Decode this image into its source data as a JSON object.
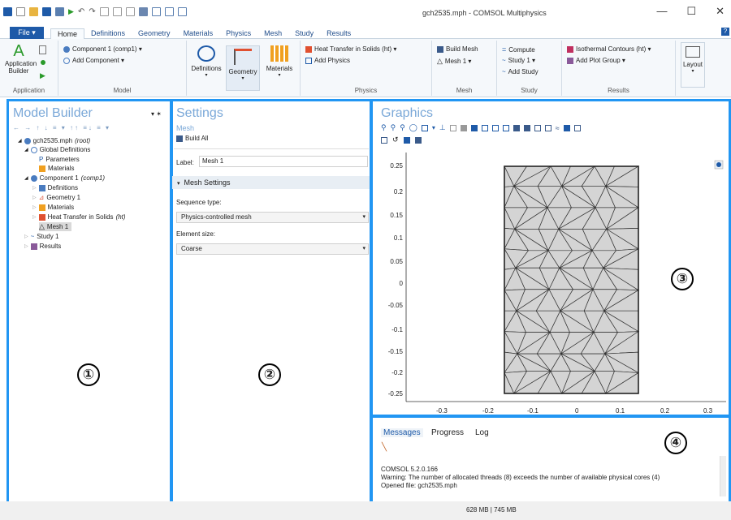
{
  "window": {
    "title": "gch2535.mph - COMSOL Multiphysics",
    "minimize": "—",
    "maximize": "☐",
    "close": "✕"
  },
  "menu": {
    "file": "File ▾",
    "tabs": [
      "Home",
      "Definitions",
      "Geometry",
      "Materials",
      "Physics",
      "Mesh",
      "Study",
      "Results"
    ],
    "help": "?"
  },
  "ribbon": {
    "application": {
      "builder_label": "Application Builder",
      "group_label": "Application"
    },
    "model": {
      "component": "Component 1 (comp1) ▾",
      "add_component": "Add Component ▾",
      "group_label": "Model"
    },
    "definitions": "Definitions",
    "geometry": "Geometry",
    "materials": "Materials",
    "physics": {
      "heat": "Heat Transfer in Solids (ht) ▾",
      "add_physics": "Add Physics",
      "group_label": "Physics"
    },
    "mesh": {
      "build_mesh": "Build Mesh",
      "mesh1": "Mesh 1 ▾",
      "group_label": "Mesh"
    },
    "study": {
      "compute": "Compute",
      "study1": "Study 1 ▾",
      "add_study": "Add Study",
      "group_label": "Study"
    },
    "results": {
      "isothermal": "Isothermal Contours (ht) ▾",
      "add_plot_group": "Add Plot Group ▾",
      "group_label": "Results"
    },
    "layout": "Layout"
  },
  "model_builder": {
    "title": "Model Builder",
    "toolbar": "← → ↑ ↓ ≡ ▾ ↑↑ ≡↓ ≡ ▾",
    "tree": [
      {
        "label": "gch2535.mph",
        "note": "(root)"
      },
      {
        "label": "Global Definitions",
        "note": ""
      },
      {
        "label": "Parameters",
        "note": ""
      },
      {
        "label": "Materials",
        "note": ""
      },
      {
        "label": "Component 1",
        "note": "(comp1)"
      },
      {
        "label": "Definitions",
        "note": ""
      },
      {
        "label": "Geometry 1",
        "note": ""
      },
      {
        "label": "Materials",
        "note": ""
      },
      {
        "label": "Heat Transfer in Solids",
        "note": "(ht)"
      },
      {
        "label": "Mesh 1",
        "note": ""
      },
      {
        "label": "Study 1",
        "note": ""
      },
      {
        "label": "Results",
        "note": ""
      }
    ]
  },
  "settings": {
    "title": "Settings",
    "subtitle": "Mesh",
    "build_all": "Build All",
    "label_caption": "Label:",
    "label_value": "Mesh 1",
    "section": "Mesh Settings",
    "sequence_caption": "Sequence type:",
    "sequence_value": "Physics-controlled mesh",
    "element_caption": "Element size:",
    "element_value": "Coarse"
  },
  "graphics": {
    "title": "Graphics",
    "y_ticks": [
      "0.25",
      "0.2",
      "0.15",
      "0.1",
      "0.05",
      "0",
      "-0.05",
      "-0.1",
      "-0.15",
      "-0.2",
      "-0.25"
    ],
    "x_ticks": [
      "-0.3",
      "-0.2",
      "-0.1",
      "0",
      "0.1",
      "0.2",
      "0.3"
    ]
  },
  "messages": {
    "tabs": [
      "Messages",
      "Progress",
      "Log"
    ],
    "lines": [
      "COMSOL 5.2.0.166",
      "Warning: The number of allocated threads (8) exceeds the number of available physical cores (4)",
      "Opened file: gch2535.mph"
    ]
  },
  "status": {
    "memory": "628 MB | 745 MB"
  },
  "annotations": [
    "①",
    "②",
    "③",
    "④"
  ],
  "colors": {
    "accent": "#2196f3",
    "file_button": "#1e5aa8",
    "panel_title": "#7aa8d8"
  }
}
